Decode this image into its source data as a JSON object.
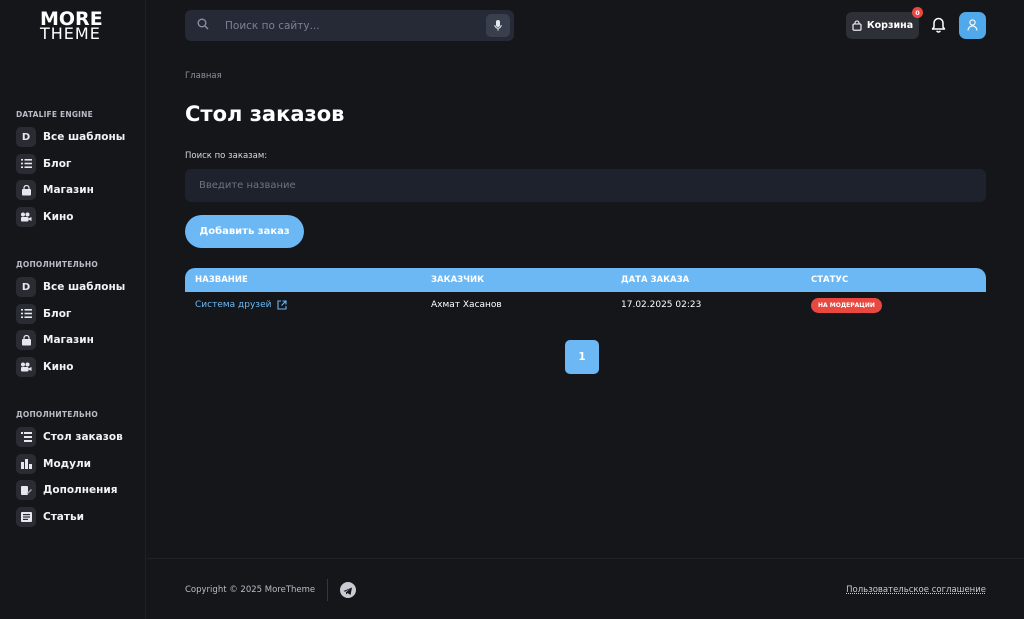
{
  "logo": {
    "line1": "MORE",
    "line2": "THEME"
  },
  "sidebar": {
    "sections": [
      {
        "title": "DATALIFE ENGINE",
        "items": [
          {
            "label": "Все шаблоны",
            "icon": "letter-d-icon"
          },
          {
            "label": "Блог",
            "icon": "list-icon"
          },
          {
            "label": "Магазин",
            "icon": "shop-bag-icon"
          },
          {
            "label": "Кино",
            "icon": "camera-icon"
          }
        ]
      },
      {
        "title": "ДОПОЛНИТЕЛЬНО",
        "items": [
          {
            "label": "Все шаблоны",
            "icon": "letter-d-icon"
          },
          {
            "label": "Блог",
            "icon": "list-icon"
          },
          {
            "label": "Магазин",
            "icon": "shop-bag-icon"
          },
          {
            "label": "Кино",
            "icon": "camera-icon"
          }
        ]
      },
      {
        "title": "ДОПОЛНИТЕЛЬНО",
        "items": [
          {
            "label": "Стол заказов",
            "icon": "orders-icon"
          },
          {
            "label": "Модули",
            "icon": "modules-icon"
          },
          {
            "label": "Дополнения",
            "icon": "addons-icon"
          },
          {
            "label": "Статьи",
            "icon": "articles-icon"
          }
        ]
      }
    ]
  },
  "header": {
    "search_placeholder": "Поиск по сайту...",
    "cart_label": "Корзина",
    "cart_count": "0"
  },
  "main": {
    "breadcrumb": "Главная",
    "title": "Стол заказов",
    "search_label": "Поиск по заказам:",
    "search_placeholder": "Введите название",
    "add_button": "Добавить заказ",
    "table": {
      "headers": [
        "НАЗВАНИЕ",
        "ЗАКАЗЧИК",
        "ДАТА ЗАКАЗА",
        "СТАТУС"
      ],
      "rows": [
        {
          "name": "Система друзей",
          "customer": "Ахмат Хасанов",
          "date": "17.02.2025 02:23",
          "status": "НА МОДЕРАЦИИ"
        }
      ]
    },
    "pagination": {
      "current": "1"
    }
  },
  "footer": {
    "copyright": "Copyright © 2025 MoreTheme",
    "agreement": "Пользовательское соглашение"
  },
  "colors": {
    "accent": "#6cb8f5",
    "background": "#15161a",
    "status_red": "#e8483f"
  }
}
